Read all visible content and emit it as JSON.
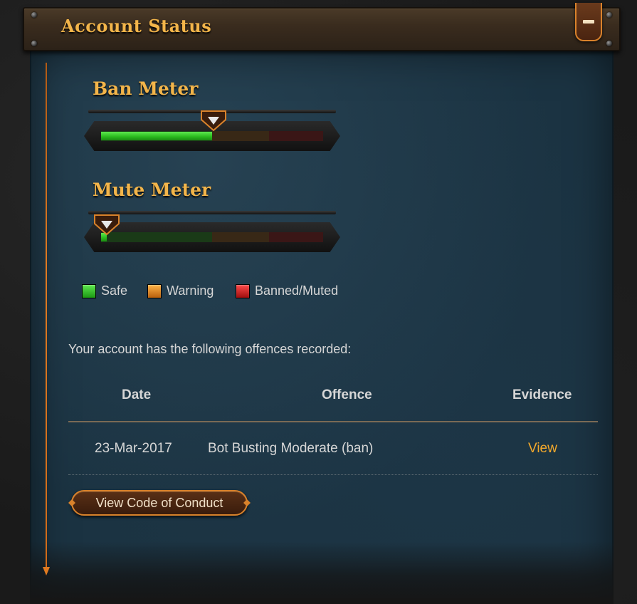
{
  "header": {
    "title": "Account Status",
    "collapse_icon": "minus-icon"
  },
  "meters": {
    "ban": {
      "title": "Ban Meter",
      "level": 0.5
    },
    "mute": {
      "title": "Mute Meter",
      "level": 0.02
    }
  },
  "legend": [
    {
      "label": "Safe",
      "color": "#2fc61f"
    },
    {
      "label": "Warning",
      "color": "#e88a1c"
    },
    {
      "label": "Banned/Muted",
      "color": "#d21a1a"
    }
  ],
  "offences": {
    "intro": "Your account has the following offences recorded:",
    "columns": {
      "date": "Date",
      "offence": "Offence",
      "evidence": "Evidence"
    },
    "rows": [
      {
        "date": "23-Mar-2017",
        "offence": "Bot Busting Moderate (ban)",
        "evidence": "View"
      }
    ]
  },
  "code_of_conduct_button": "View Code of Conduct",
  "colors": {
    "accent": "#f3b54a",
    "panel": "#1b3342",
    "link": "#f3a92c"
  }
}
